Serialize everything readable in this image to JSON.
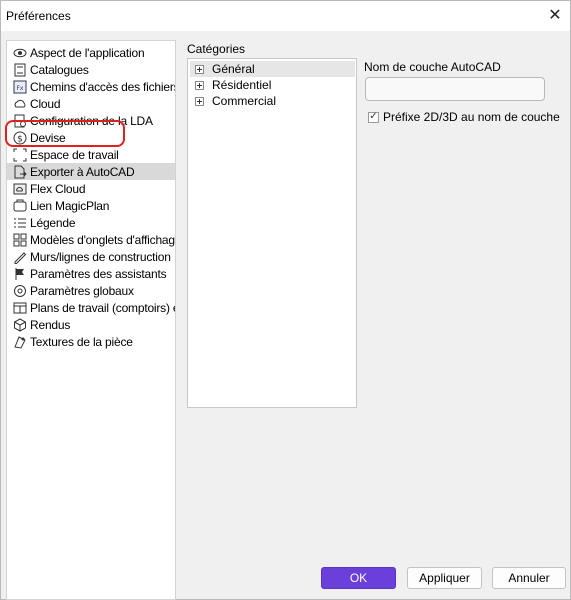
{
  "window": {
    "title": "Préférences",
    "close_glyph": "✕"
  },
  "nav": {
    "items": [
      {
        "label": "Aspect de l'application",
        "icon": "eye-icon"
      },
      {
        "label": "Catalogues",
        "icon": "catalog-icon"
      },
      {
        "label": "Chemins d'accès des fichiers",
        "icon": "file-paths-icon"
      },
      {
        "label": "Cloud",
        "icon": "cloud-icon"
      },
      {
        "label": "Configuration de la LDA",
        "icon": "lda-config-icon"
      },
      {
        "label": "Devise",
        "icon": "currency-icon"
      },
      {
        "label": "Espace de travail",
        "icon": "workspace-icon"
      },
      {
        "label": "Exporter à AutoCAD",
        "icon": "export-autocad-icon",
        "selected": true
      },
      {
        "label": "Flex Cloud",
        "icon": "flex-cloud-icon"
      },
      {
        "label": "Lien MagicPlan",
        "icon": "magicplan-icon"
      },
      {
        "label": "Légende",
        "icon": "legend-icon"
      },
      {
        "label": "Modèles d'onglets d'affichage",
        "icon": "display-tabs-icon"
      },
      {
        "label": "Murs/lignes de construction",
        "icon": "walls-icon"
      },
      {
        "label": "Paramètres des assistants",
        "icon": "flag-icon"
      },
      {
        "label": "Paramètres globaux",
        "icon": "globe-icon"
      },
      {
        "label": "Plans de travail (comptoirs) et garnitures",
        "icon": "countertop-icon"
      },
      {
        "label": "Rendus",
        "icon": "cube-icon"
      },
      {
        "label": "Textures de la pièce",
        "icon": "textures-icon"
      }
    ]
  },
  "categories": {
    "label": "Catégories",
    "items": [
      {
        "label": "Général",
        "selected": true
      },
      {
        "label": "Résidentiel"
      },
      {
        "label": "Commercial"
      }
    ]
  },
  "layer": {
    "label": "Nom de couche AutoCAD",
    "value": "",
    "prefix_label": "Préfixe 2D/3D au nom de couche",
    "prefix_checked": true
  },
  "buttons": {
    "ok": "OK",
    "apply": "Appliquer",
    "cancel": "Annuler"
  },
  "colors": {
    "ok_button": "#6b3fd9",
    "highlight": "#e0201c"
  }
}
